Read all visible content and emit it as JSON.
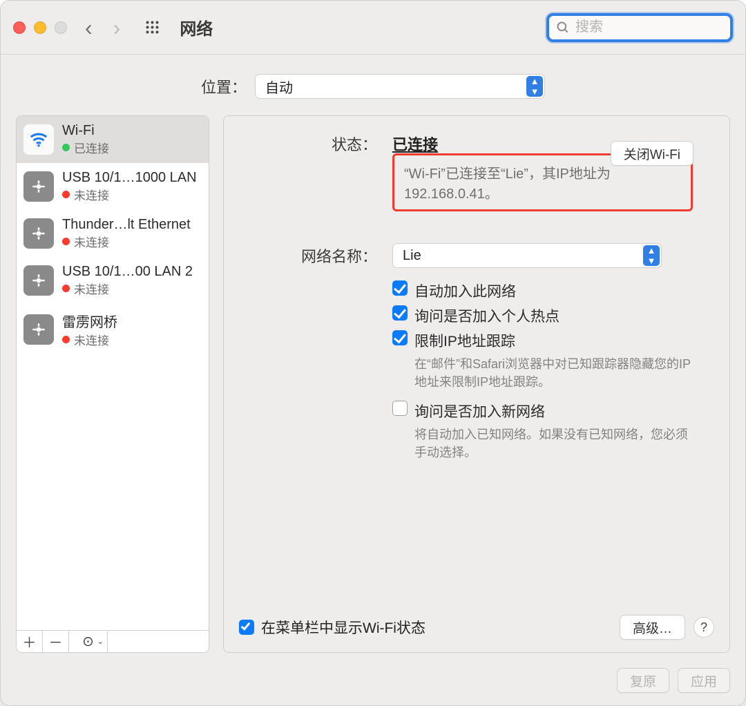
{
  "window": {
    "title": "网络"
  },
  "search": {
    "placeholder": "搜索"
  },
  "location": {
    "label": "位置：",
    "value": "自动"
  },
  "sidebar": {
    "items": [
      {
        "name": "Wi-Fi",
        "status": "已连接",
        "connected": true,
        "kind": "wifi"
      },
      {
        "name": "USB 10/1…1000 LAN",
        "status": "未连接",
        "connected": false,
        "kind": "eth"
      },
      {
        "name": "Thunder…lt Ethernet",
        "status": "未连接",
        "connected": false,
        "kind": "eth"
      },
      {
        "name": "USB 10/1…00 LAN 2",
        "status": "未连接",
        "connected": false,
        "kind": "eth"
      },
      {
        "name": "雷雳网桥",
        "status": "未连接",
        "connected": false,
        "kind": "eth"
      }
    ]
  },
  "details": {
    "statusLabel": "状态：",
    "statusValue": "已连接",
    "statusDetail": "“Wi-Fi”已连接至“Lie”，其IP地址为192.168.0.41。",
    "toggleWifi": "关闭Wi-Fi",
    "networkNameLabel": "网络名称：",
    "networkName": "Lie",
    "checks": {
      "autojoin": "自动加入此网络",
      "askHotspot": "询问是否加入个人热点",
      "limitTracking": "限制IP地址跟踪",
      "limitTrackingSub": "在“邮件”和Safari浏览器中对已知跟踪器隐藏您的IP地址来限制IP地址跟踪。",
      "askNew": "询问是否加入新网络",
      "askNewSub": "将自动加入已知网络。如果没有已知网络，您必须手动选择。"
    },
    "showMenuBar": "在菜单栏中显示Wi-Fi状态",
    "advanced": "高级…"
  },
  "footer": {
    "revert": "复原",
    "apply": "应用"
  }
}
